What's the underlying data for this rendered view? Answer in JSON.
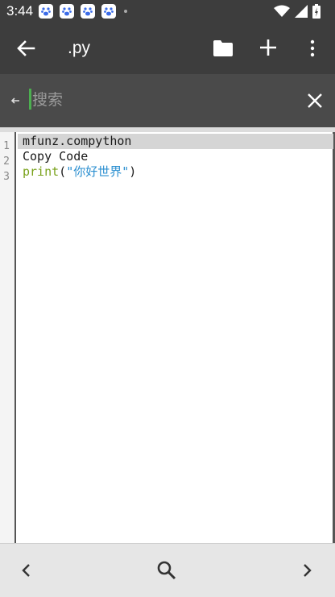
{
  "statusbar": {
    "time": "3:44",
    "notification_icons": [
      "baidu-paw-icon",
      "baidu-paw-icon",
      "baidu-paw-icon",
      "baidu-paw-icon"
    ],
    "system_icons": [
      "wifi-icon",
      "signal-icon",
      "battery-icon"
    ]
  },
  "toolbar": {
    "title": ".py",
    "icons": [
      "back-arrow-icon",
      "folder-icon",
      "plus-icon",
      "more-vert-icon"
    ]
  },
  "search": {
    "placeholder": "搜索",
    "value": ""
  },
  "editor": {
    "line_numbers": [
      "1",
      "2",
      "3"
    ],
    "line1": "mfunz.compython",
    "line2": "Copy Code",
    "line3_fn": "print",
    "line3_open": "(",
    "line3_str": "\"你好世界\"",
    "line3_close": ")"
  },
  "bottombar": {
    "icons": [
      "chevron-left-icon",
      "search-icon",
      "chevron-right-icon"
    ]
  },
  "colors": {
    "bar_bg": "#3d3d3d",
    "search_bg": "#4a4a4a",
    "function": "#7aa21c",
    "string": "#2b8fd0",
    "cursor": "#4caf50",
    "highlight": "#d5d5d5"
  }
}
